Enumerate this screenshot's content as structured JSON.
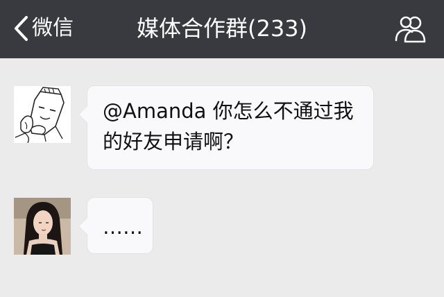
{
  "nav": {
    "back_label": "微信",
    "title": "媒体合作群(233)",
    "back_icon": "chevron-left-icon",
    "group_icon": "group-members-icon"
  },
  "colors": {
    "nav_background": "#393a3f",
    "chat_background": "#ebebeb",
    "bubble_background": "#f9f9fb"
  },
  "messages": [
    {
      "avatar": "cartoon-sketch-avatar",
      "text": "@Amanda 你怎么不通过我的好友申请啊？"
    },
    {
      "avatar": "woman-photo-avatar",
      "text": "……"
    }
  ]
}
